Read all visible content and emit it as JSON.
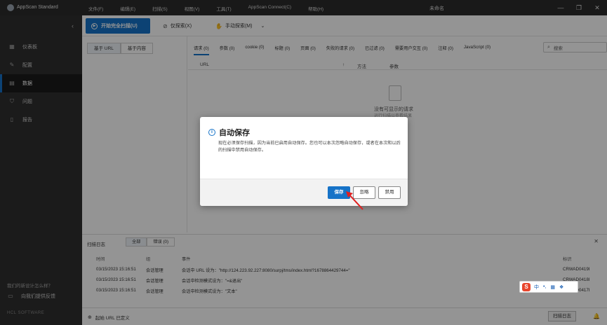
{
  "app": {
    "name": "AppScan Standard",
    "doc_title": "未命名"
  },
  "menu": [
    "文件(F)",
    "编辑(E)",
    "扫描(S)",
    "视图(V)",
    "工具(T)",
    "AppScan Connect(C)",
    "帮助(H)"
  ],
  "window_controls": {
    "minimize": "—",
    "restore": "❐",
    "close": "✕"
  },
  "sidebar": {
    "collapse": "‹",
    "items": [
      {
        "label": "仪表板",
        "icon": "dashboard-icon",
        "glyph": "▦",
        "active": false
      },
      {
        "label": "配置",
        "icon": "wrench-icon",
        "glyph": "✎",
        "active": false
      },
      {
        "label": "数据",
        "icon": "data-icon",
        "glyph": "▤",
        "active": true
      },
      {
        "label": "问题",
        "icon": "shield-icon",
        "glyph": "⛉",
        "active": false
      },
      {
        "label": "报告",
        "icon": "report-icon",
        "glyph": "▯",
        "active": false
      }
    ],
    "footer_question": "我们的新设计怎么样？",
    "feedback": "向我们提供反馈",
    "feedback_glyph": "▭",
    "vendor": "HCL SOFTWARE"
  },
  "toolbar": {
    "full_scan": "开始完全扫描(U)",
    "explore_only": "仅探索(X)",
    "manual_explore": "手动探索(M)",
    "explore_glyph": "⊘",
    "manual_glyph": "✋",
    "dropdown_glyph": "⌄"
  },
  "left_tabs": [
    "基于 URL",
    "基于内容"
  ],
  "request_tabs": [
    "请求 (0)",
    "参数 (0)",
    "cookie (0)",
    "标题 (0)",
    "页面 (0)",
    "失败的请求 (0)",
    "已过滤 (0)",
    "需要用户交互 (0)",
    "注释 (0)",
    "JavaScript (0)"
  ],
  "search": {
    "placeholder": "搜索",
    "glyph": "⌕"
  },
  "grid_columns": {
    "url": "URL",
    "sort_glyph": "↑",
    "method": "方法",
    "params": "参数"
  },
  "empty_state": {
    "title": "没有可显示的请求",
    "subtitle": "运行扫描以查看结果"
  },
  "scan_log": {
    "title": "扫描日志",
    "tabs": [
      "全部",
      "错误 (0)"
    ],
    "close": "✕",
    "columns": {
      "time": "时间",
      "group": "组",
      "event": "事件",
      "id": "标识"
    },
    "rows": [
      {
        "time": "03/15/2023 15:16:51",
        "group": "会话管理",
        "event": "会话中 URL 设为：\"http://124.223.92.227:8080/surpj/tms/index.html?1678864429744=\"",
        "id": "CRWAD0419I"
      },
      {
        "time": "03/15/2023 15:16:51",
        "group": "会话管理",
        "event": "会话中检测模式设为：\"=&退出\"",
        "id": "CRWAD0418I"
      },
      {
        "time": "03/15/2023 15:16:51",
        "group": "会话管理",
        "event": "会话中检测模式设为：\"文本\"",
        "id": "CRWAD0417I"
      }
    ]
  },
  "status_bar": {
    "start_url": "起始 URL 已定义",
    "scan_log_button": "扫描日志",
    "globe_glyph": "⊕",
    "bell_glyph": "🔔"
  },
  "dialog": {
    "title": "自动保存",
    "info_glyph": "i",
    "message": "现在必须保存扫描，因为当前已启用自动保存。您也可以本次忽略自动保存，或者在本次和以后的扫描中禁用自动保存。",
    "buttons": {
      "save": "保存",
      "ignore": "忽略",
      "disable": "禁用"
    }
  },
  "ime": {
    "logo": "S",
    "items": [
      "中",
      "•,",
      "▦",
      "❖"
    ]
  },
  "colors": {
    "accent": "#1673c8",
    "sidebar_bg": "#2f2f2f",
    "annotation_arrow": "#e02020"
  }
}
